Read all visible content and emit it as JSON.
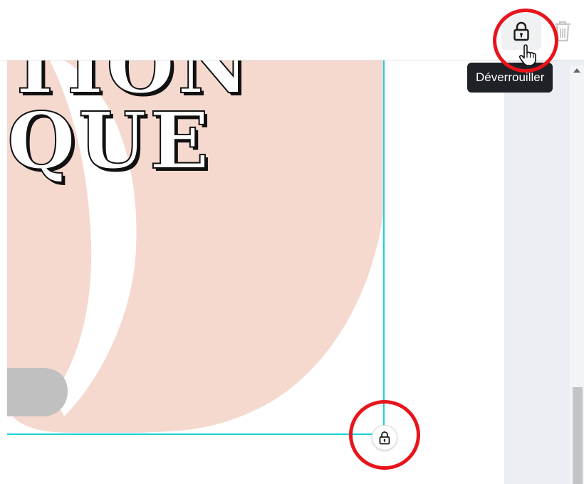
{
  "toolbar": {
    "lock_button_tooltip": "Déverrouiller",
    "lock_icon": "padlock-icon",
    "trash_icon": "trash-icon",
    "cursor_icon": "hand-pointer-icon"
  },
  "canvas": {
    "headline_line_1": "TION",
    "headline_line_2": "QUE",
    "selection_lock_icon": "padlock-icon"
  },
  "colors": {
    "blob_fill": "#f5d9cf",
    "selection_outline": "#19d3de",
    "highlight_ring": "#e8141b",
    "gray_pill": "#c0c0c0",
    "tooltip_bg": "#1e2227"
  }
}
